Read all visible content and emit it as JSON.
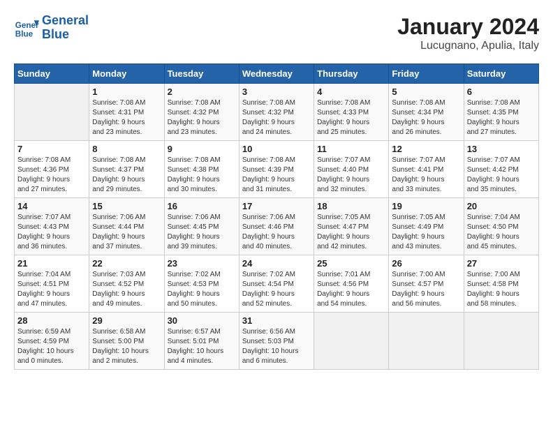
{
  "logo": {
    "line1": "General",
    "line2": "Blue"
  },
  "title": "January 2024",
  "subtitle": "Lucugnano, Apulia, Italy",
  "days_of_week": [
    "Sunday",
    "Monday",
    "Tuesday",
    "Wednesday",
    "Thursday",
    "Friday",
    "Saturday"
  ],
  "weeks": [
    [
      {
        "num": "",
        "info": ""
      },
      {
        "num": "1",
        "info": "Sunrise: 7:08 AM\nSunset: 4:31 PM\nDaylight: 9 hours\nand 23 minutes."
      },
      {
        "num": "2",
        "info": "Sunrise: 7:08 AM\nSunset: 4:32 PM\nDaylight: 9 hours\nand 23 minutes."
      },
      {
        "num": "3",
        "info": "Sunrise: 7:08 AM\nSunset: 4:32 PM\nDaylight: 9 hours\nand 24 minutes."
      },
      {
        "num": "4",
        "info": "Sunrise: 7:08 AM\nSunset: 4:33 PM\nDaylight: 9 hours\nand 25 minutes."
      },
      {
        "num": "5",
        "info": "Sunrise: 7:08 AM\nSunset: 4:34 PM\nDaylight: 9 hours\nand 26 minutes."
      },
      {
        "num": "6",
        "info": "Sunrise: 7:08 AM\nSunset: 4:35 PM\nDaylight: 9 hours\nand 27 minutes."
      }
    ],
    [
      {
        "num": "7",
        "info": "Sunrise: 7:08 AM\nSunset: 4:36 PM\nDaylight: 9 hours\nand 27 minutes."
      },
      {
        "num": "8",
        "info": "Sunrise: 7:08 AM\nSunset: 4:37 PM\nDaylight: 9 hours\nand 29 minutes."
      },
      {
        "num": "9",
        "info": "Sunrise: 7:08 AM\nSunset: 4:38 PM\nDaylight: 9 hours\nand 30 minutes."
      },
      {
        "num": "10",
        "info": "Sunrise: 7:08 AM\nSunset: 4:39 PM\nDaylight: 9 hours\nand 31 minutes."
      },
      {
        "num": "11",
        "info": "Sunrise: 7:07 AM\nSunset: 4:40 PM\nDaylight: 9 hours\nand 32 minutes."
      },
      {
        "num": "12",
        "info": "Sunrise: 7:07 AM\nSunset: 4:41 PM\nDaylight: 9 hours\nand 33 minutes."
      },
      {
        "num": "13",
        "info": "Sunrise: 7:07 AM\nSunset: 4:42 PM\nDaylight: 9 hours\nand 35 minutes."
      }
    ],
    [
      {
        "num": "14",
        "info": "Sunrise: 7:07 AM\nSunset: 4:43 PM\nDaylight: 9 hours\nand 36 minutes."
      },
      {
        "num": "15",
        "info": "Sunrise: 7:06 AM\nSunset: 4:44 PM\nDaylight: 9 hours\nand 37 minutes."
      },
      {
        "num": "16",
        "info": "Sunrise: 7:06 AM\nSunset: 4:45 PM\nDaylight: 9 hours\nand 39 minutes."
      },
      {
        "num": "17",
        "info": "Sunrise: 7:06 AM\nSunset: 4:46 PM\nDaylight: 9 hours\nand 40 minutes."
      },
      {
        "num": "18",
        "info": "Sunrise: 7:05 AM\nSunset: 4:47 PM\nDaylight: 9 hours\nand 42 minutes."
      },
      {
        "num": "19",
        "info": "Sunrise: 7:05 AM\nSunset: 4:49 PM\nDaylight: 9 hours\nand 43 minutes."
      },
      {
        "num": "20",
        "info": "Sunrise: 7:04 AM\nSunset: 4:50 PM\nDaylight: 9 hours\nand 45 minutes."
      }
    ],
    [
      {
        "num": "21",
        "info": "Sunrise: 7:04 AM\nSunset: 4:51 PM\nDaylight: 9 hours\nand 47 minutes."
      },
      {
        "num": "22",
        "info": "Sunrise: 7:03 AM\nSunset: 4:52 PM\nDaylight: 9 hours\nand 49 minutes."
      },
      {
        "num": "23",
        "info": "Sunrise: 7:02 AM\nSunset: 4:53 PM\nDaylight: 9 hours\nand 50 minutes."
      },
      {
        "num": "24",
        "info": "Sunrise: 7:02 AM\nSunset: 4:54 PM\nDaylight: 9 hours\nand 52 minutes."
      },
      {
        "num": "25",
        "info": "Sunrise: 7:01 AM\nSunset: 4:56 PM\nDaylight: 9 hours\nand 54 minutes."
      },
      {
        "num": "26",
        "info": "Sunrise: 7:00 AM\nSunset: 4:57 PM\nDaylight: 9 hours\nand 56 minutes."
      },
      {
        "num": "27",
        "info": "Sunrise: 7:00 AM\nSunset: 4:58 PM\nDaylight: 9 hours\nand 58 minutes."
      }
    ],
    [
      {
        "num": "28",
        "info": "Sunrise: 6:59 AM\nSunset: 4:59 PM\nDaylight: 10 hours\nand 0 minutes."
      },
      {
        "num": "29",
        "info": "Sunrise: 6:58 AM\nSunset: 5:00 PM\nDaylight: 10 hours\nand 2 minutes."
      },
      {
        "num": "30",
        "info": "Sunrise: 6:57 AM\nSunset: 5:01 PM\nDaylight: 10 hours\nand 4 minutes."
      },
      {
        "num": "31",
        "info": "Sunrise: 6:56 AM\nSunset: 5:03 PM\nDaylight: 10 hours\nand 6 minutes."
      },
      {
        "num": "",
        "info": ""
      },
      {
        "num": "",
        "info": ""
      },
      {
        "num": "",
        "info": ""
      }
    ]
  ]
}
